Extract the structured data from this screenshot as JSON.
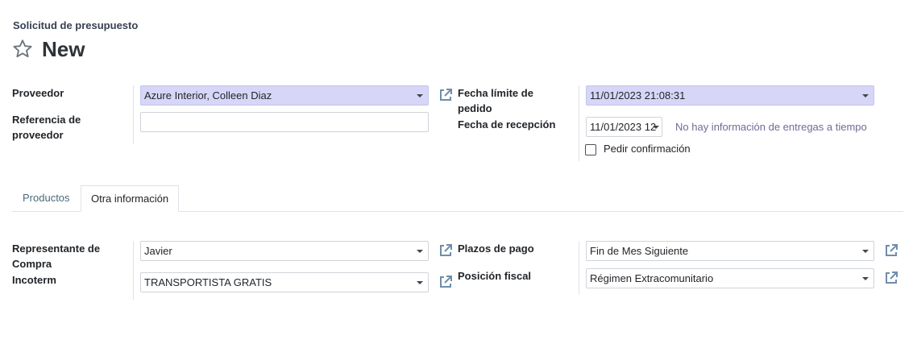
{
  "breadcrumb": "Solicitud de presupuesto",
  "title": "New",
  "fields": {
    "proveedor_label": "Proveedor",
    "proveedor_value": "Azure Interior, Colleen Diaz",
    "referencia_label": "Referencia de proveedor",
    "referencia_value": "",
    "fecha_limite_label": "Fecha límite de pedido",
    "fecha_limite_value": "11/01/2023 21:08:31",
    "fecha_recepcion_label": "Fecha de recepción",
    "fecha_recepcion_value": "11/01/2023 12",
    "entregas_info": "No hay información de entregas a tiempo",
    "pedir_confirmacion_label": "Pedir confirmación"
  },
  "tabs": [
    {
      "label": "Productos",
      "active": false
    },
    {
      "label": "Otra información",
      "active": true
    }
  ],
  "otra": {
    "representante_label": "Representante de Compra",
    "representante_value": "Javier",
    "incoterm_label": "Incoterm",
    "incoterm_value": "TRANSPORTISTA GRATIS",
    "plazos_label": "Plazos de pago",
    "plazos_value": "Fin de Mes Siguiente",
    "posicion_label": "Posición fiscal",
    "posicion_value": "Régimen Extracomunitario"
  },
  "icons": {
    "star": "star-outline-icon",
    "external": "external-link-icon",
    "caret": "caret-down-icon"
  },
  "colors": {
    "highlight": "#d6d6f8",
    "muted_text": "#6c6c9a",
    "icon": "#6e8eac"
  }
}
